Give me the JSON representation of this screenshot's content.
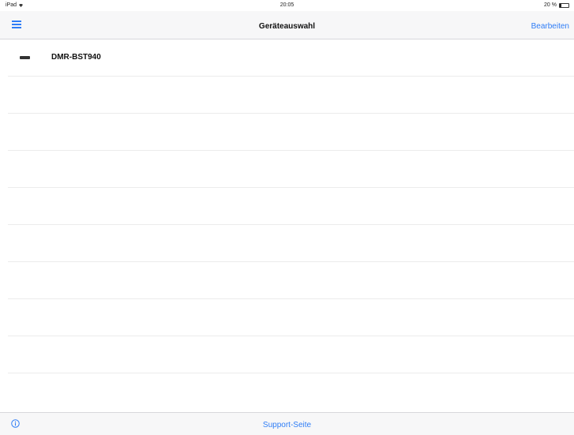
{
  "status": {
    "device": "iPad",
    "time": "20:05",
    "battery": "20 %",
    "battery_level": 0.2
  },
  "nav": {
    "title": "Geräteauswahl",
    "edit_label": "Bearbeiten"
  },
  "devices": [
    {
      "label": "DMR-BST940"
    }
  ],
  "footer": {
    "support_label": "Support-Seite"
  },
  "colors": {
    "accent": "#2f7df6",
    "separator": "#ececec",
    "bar_background": "#f7f7f8"
  },
  "icons": {
    "menu": "menu-icon",
    "device": "device-icon",
    "info": "info-icon"
  }
}
